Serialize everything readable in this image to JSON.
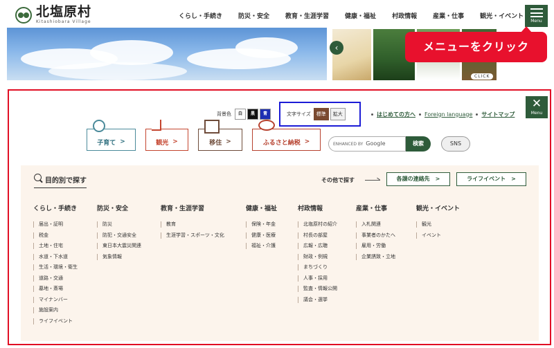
{
  "header": {
    "logo_title": "北塩原村",
    "logo_sub": "Kitashiobara Village",
    "nav": [
      "くらし・手続き",
      "防災・安全",
      "教育・生涯学習",
      "健康・福祉",
      "村政情報",
      "産業・仕事",
      "観光・イベント"
    ],
    "menu_label": "Menu"
  },
  "banner": {
    "callout": "メニューをクリック",
    "click_label": "CLICK",
    "prev_icon": "chevron-left-icon",
    "next_icon": "chevron-right-icon"
  },
  "panel": {
    "close_label": "Menu",
    "background_color_label": "背景色",
    "bg_options": [
      "白",
      "黒",
      "青"
    ],
    "font_size_label": "文字サイズ",
    "font_size_options": [
      "標準",
      "拡大"
    ],
    "font_size_selected": "標準",
    "top_links": [
      "はじめての方へ",
      "Foreign language",
      "サイトマップ"
    ],
    "features": [
      {
        "label": "子育て",
        "icon": "child-icon",
        "color": "#2d6e7e"
      },
      {
        "label": "観光",
        "icon": "flag-icon",
        "color": "#c4442e"
      },
      {
        "label": "移住",
        "icon": "house-icon",
        "color": "#6e4b39"
      },
      {
        "label": "ふるさと納税",
        "icon": "ribbon-icon",
        "color": "#b6402d"
      }
    ],
    "search": {
      "placeholder_prefix": "ENHANCED BY",
      "placeholder_brand": "Google",
      "button": "検索"
    },
    "sns_label": "SNS",
    "purpose_title": "目的別で探す",
    "other_label": "その他で探す",
    "other_links": [
      "各課の連絡先",
      "ライフイベント"
    ],
    "chevron": ">",
    "columns": [
      {
        "head": "くらし・手続き",
        "items": [
          "届出・証明",
          "税金",
          "土地・住宅",
          "水道・下水道",
          "生活・環境・衛生",
          "道路・交通",
          "墓地・斎場",
          "マイナンバー",
          "施設案内",
          "ライフイベント"
        ]
      },
      {
        "head": "防災・安全",
        "items": [
          "防災",
          "防犯・交通安全",
          "東日本大震災関連",
          "気象情報"
        ]
      },
      {
        "head": "教育・生涯学習",
        "items": [
          "教育",
          "生涯学習・スポーツ・文化"
        ]
      },
      {
        "head": "健康・福祉",
        "items": [
          "保険・年金",
          "健康・医療",
          "福祉・介護"
        ]
      },
      {
        "head": "村政情報",
        "items": [
          "北塩原村の紹介",
          "村長の部屋",
          "広報・広聴",
          "財政・例規",
          "まちづくり",
          "人事・採用",
          "監査・情報公開",
          "議会・選挙"
        ]
      },
      {
        "head": "産業・仕事",
        "items": [
          "入札関連",
          "事業者のかたへ",
          "雇用・労働",
          "企業誘致・立地"
        ]
      },
      {
        "head": "観光・イベント",
        "items": [
          "観光",
          "イベント"
        ]
      }
    ]
  },
  "colors": {
    "accent_green": "#2e5b3a",
    "highlight_red": "#e10e24",
    "highlight_blue": "#1b1bd6"
  }
}
